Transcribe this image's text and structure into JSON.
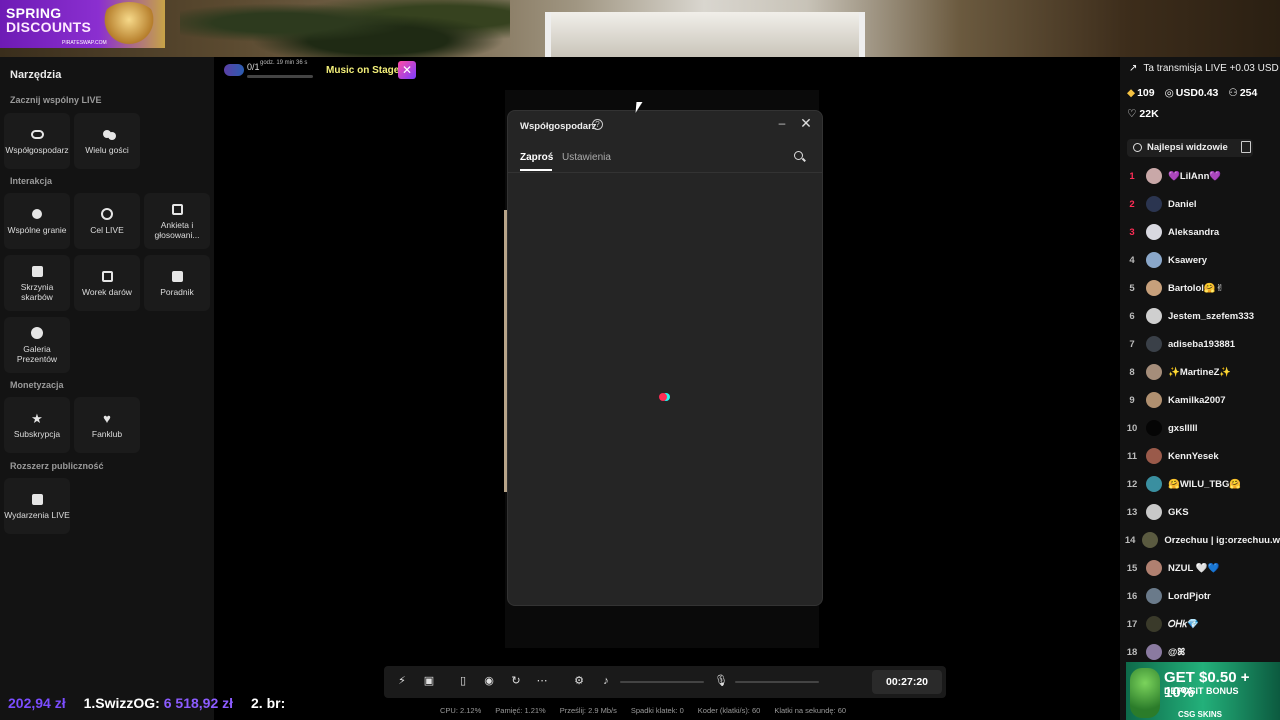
{
  "ad_top": {
    "line1": "SPRING",
    "line2": "DISCOUNTS",
    "line3": "PIRATESWAP.COM"
  },
  "tools": {
    "title": "Narzędzia",
    "sections": {
      "coop": "Zacznij wspólny LIVE",
      "interaction": "Interakcja",
      "monetization": "Monetyzacja",
      "reach": "Rozszerz publiczność"
    },
    "items": {
      "cohost": "Współgospodarz",
      "multi_guest": "Wielu gości",
      "coop_play": "Wspólne granie",
      "live_goal": "Cel LIVE",
      "poll": "Ankieta i głosowani...",
      "treasure": "Skrzynia skarbów",
      "gift_bag": "Worek darów",
      "guide": "Poradnik",
      "gift_gallery": "Galeria Prezentów",
      "subscription": "Subskrypcja",
      "fanclub": "Fanklub",
      "live_events": "Wydarzenia LIVE"
    }
  },
  "widget": {
    "count": "0/1",
    "time": "godz. 19 min 36 s",
    "progress": 0.0
  },
  "music_stage": "Music on Stage",
  "modal": {
    "title": "Współgospodarz",
    "tabs": {
      "invite": "Zaproś",
      "settings": "Ustawienia"
    }
  },
  "right": {
    "live_earn": "Ta transmisja LIVE +0.03 USD",
    "coins": "109",
    "usd": "USD0.43",
    "viewers": "254",
    "likes": "22K",
    "top_viewers_label": "Najlepsi widzowie",
    "viewers_list": [
      {
        "rank": "1",
        "name": "💜LilAnn💜",
        "color": "#c9a8a8"
      },
      {
        "rank": "2",
        "name": "Daniel",
        "color": "#2b3550"
      },
      {
        "rank": "3",
        "name": "Aleksandra",
        "color": "#d8d8e0"
      },
      {
        "rank": "4",
        "name": "Ksawery",
        "color": "#8aa7c9"
      },
      {
        "rank": "5",
        "name": "Bartolol🤗✌",
        "color": "#c7a07b"
      },
      {
        "rank": "6",
        "name": "Jestem_szefem333",
        "color": "#cfcfcf"
      },
      {
        "rank": "7",
        "name": "adiseba193881",
        "color": "#3a4048"
      },
      {
        "rank": "8",
        "name": "✨MartineZ✨",
        "color": "#a58d7a"
      },
      {
        "rank": "9",
        "name": "Kamilka2007",
        "color": "#b09070"
      },
      {
        "rank": "10",
        "name": "gxslllll",
        "color": "#050505"
      },
      {
        "rank": "11",
        "name": "KennYesek",
        "color": "#9a5a4a"
      },
      {
        "rank": "12",
        "name": "🤗WILU_TBG🤗",
        "color": "#3a8fa0"
      },
      {
        "rank": "13",
        "name": "GKS",
        "color": "#c8c8c8"
      },
      {
        "rank": "14",
        "name": "Orzechuu | ig:orzechuu.w",
        "color": "#5a5a40"
      },
      {
        "rank": "15",
        "name": "NZUL 🤍💙",
        "color": "#b08070"
      },
      {
        "rank": "16",
        "name": "LordPjotr",
        "color": "#6a7a8a"
      },
      {
        "rank": "17",
        "name": "𝑂𝐻𝑘💎",
        "color": "#3a3a2a"
      },
      {
        "rank": "18",
        "name": "@ꕤ",
        "color": "#8a7aa0"
      }
    ]
  },
  "ad_bottom": {
    "line1": "GET $0.50 + 10%",
    "line2": "DEPOSIT BONUS",
    "brand": "CSG SKINS"
  },
  "ticker": {
    "amount": "202,94 zł",
    "first": "1.SwizzOG:",
    "first_amount": "6 518,92 zł",
    "second": "2. br:"
  },
  "controls": {
    "timer": "00:27:20"
  },
  "status": {
    "cpu": "CPU: 2.12%",
    "memory": "Pamięć: 1.21%",
    "bitrate": "Prześlij: 2.9 Mb/s",
    "dropped": "Spadki klatek: 0",
    "encoder": "Koder (klatki/s): 60",
    "fps": "Klatki na sekundę: 60"
  }
}
